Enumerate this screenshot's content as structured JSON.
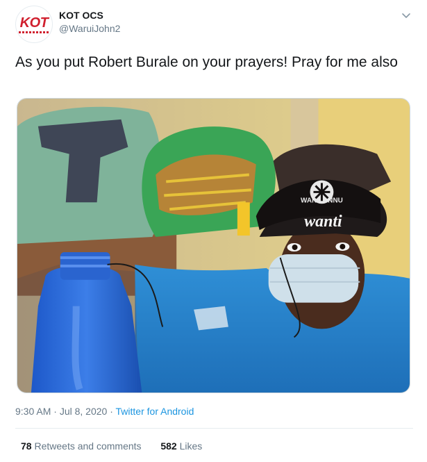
{
  "author": {
    "avatar_text": "KOT",
    "display_name": "KOT OCS",
    "handle": "@WaruiJohn2"
  },
  "tweet": {
    "text": "As you put Robert Burale on your prayers! Pray for me also",
    "time": "9:30 AM",
    "date": "Jul 8, 2020",
    "source": "Twitter for Android",
    "separator": "·"
  },
  "media": {
    "cap_text": "wanti",
    "cap_top_text": "WAN TUNNU"
  },
  "stats": {
    "retweets_count": "78",
    "retweets_label": "Retweets and comments",
    "likes_count": "582",
    "likes_label": "Likes"
  },
  "colors": {
    "link": "#1b95e0",
    "muted": "#657786",
    "text": "#14171a",
    "logo": "#d01f2e"
  },
  "icons": {
    "menu": "chevron-down-icon"
  }
}
